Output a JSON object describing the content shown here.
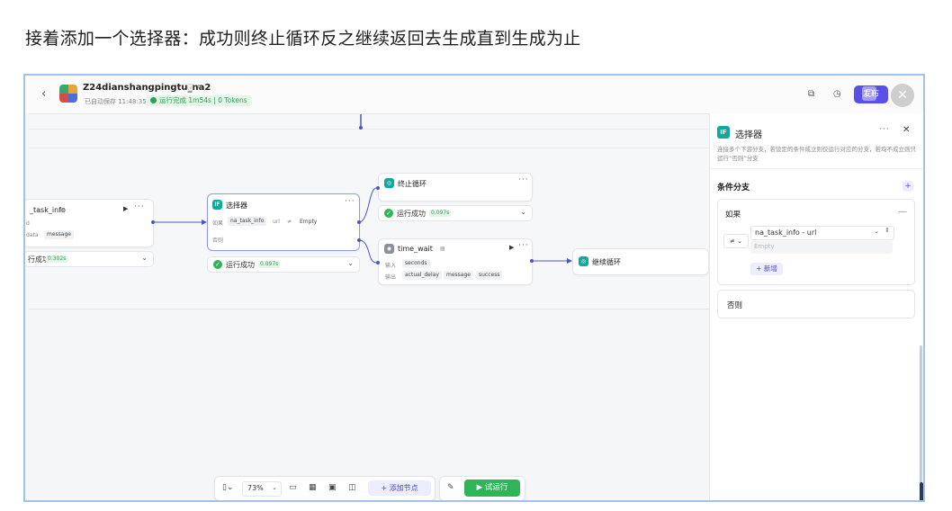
{
  "article": {
    "heading": "接着添加一个选择器：成功则终止循环反之继续返回去生成直到生成为止"
  },
  "topbar": {
    "title": "Z24dianshangpingtu_na2",
    "autosave": "已自动保存 11:48:35",
    "run_status": "运行完成 1m54s | 0 Tokens",
    "publish_label": "发布"
  },
  "nodes": {
    "task_info": {
      "title": "_task_info",
      "field_d": "d",
      "field_data": "data",
      "field_message": "message",
      "run_label": "行成功",
      "run_time": "0.302s"
    },
    "selector": {
      "title": "选择器",
      "if_label": "如果",
      "cond_var": "na_task_info",
      "cond_field": "url",
      "cond_op": "≠",
      "cond_value": "Empty",
      "else_label": "否则",
      "run_label": "运行成功",
      "run_time": "0.097s"
    },
    "stop_loop": {
      "title": "终止循环",
      "run_label": "运行成功",
      "run_time": "0.097s"
    },
    "time_wait": {
      "title": "time_wait",
      "input_label": "输入",
      "input_chip": "seconds",
      "output_label": "输出",
      "out1": "actual_delay",
      "out2": "message",
      "out3": "success"
    },
    "continue_loop": {
      "title": "继续循环"
    }
  },
  "panel": {
    "title": "选择器",
    "description": "连接多个下游分支，若设定的条件成立则仅运行对应的分支，若均不成立则只运行“否则”分支",
    "section_title": "条件分支",
    "if_label": "如果",
    "condition_op": "≠",
    "condition_var": "na_task_info - url",
    "value_placeholder": "Empty",
    "add_label": "+ 新增",
    "else_label": "否则"
  },
  "toolbar": {
    "zoom": "73%",
    "add_node_label": "+ 添加节点",
    "try_run_label": "▶ 试运行"
  },
  "colors": {
    "accent": "#5a4fe6",
    "success": "#2fb457",
    "teal": "#11a99b",
    "connector": "#4a55c8"
  }
}
